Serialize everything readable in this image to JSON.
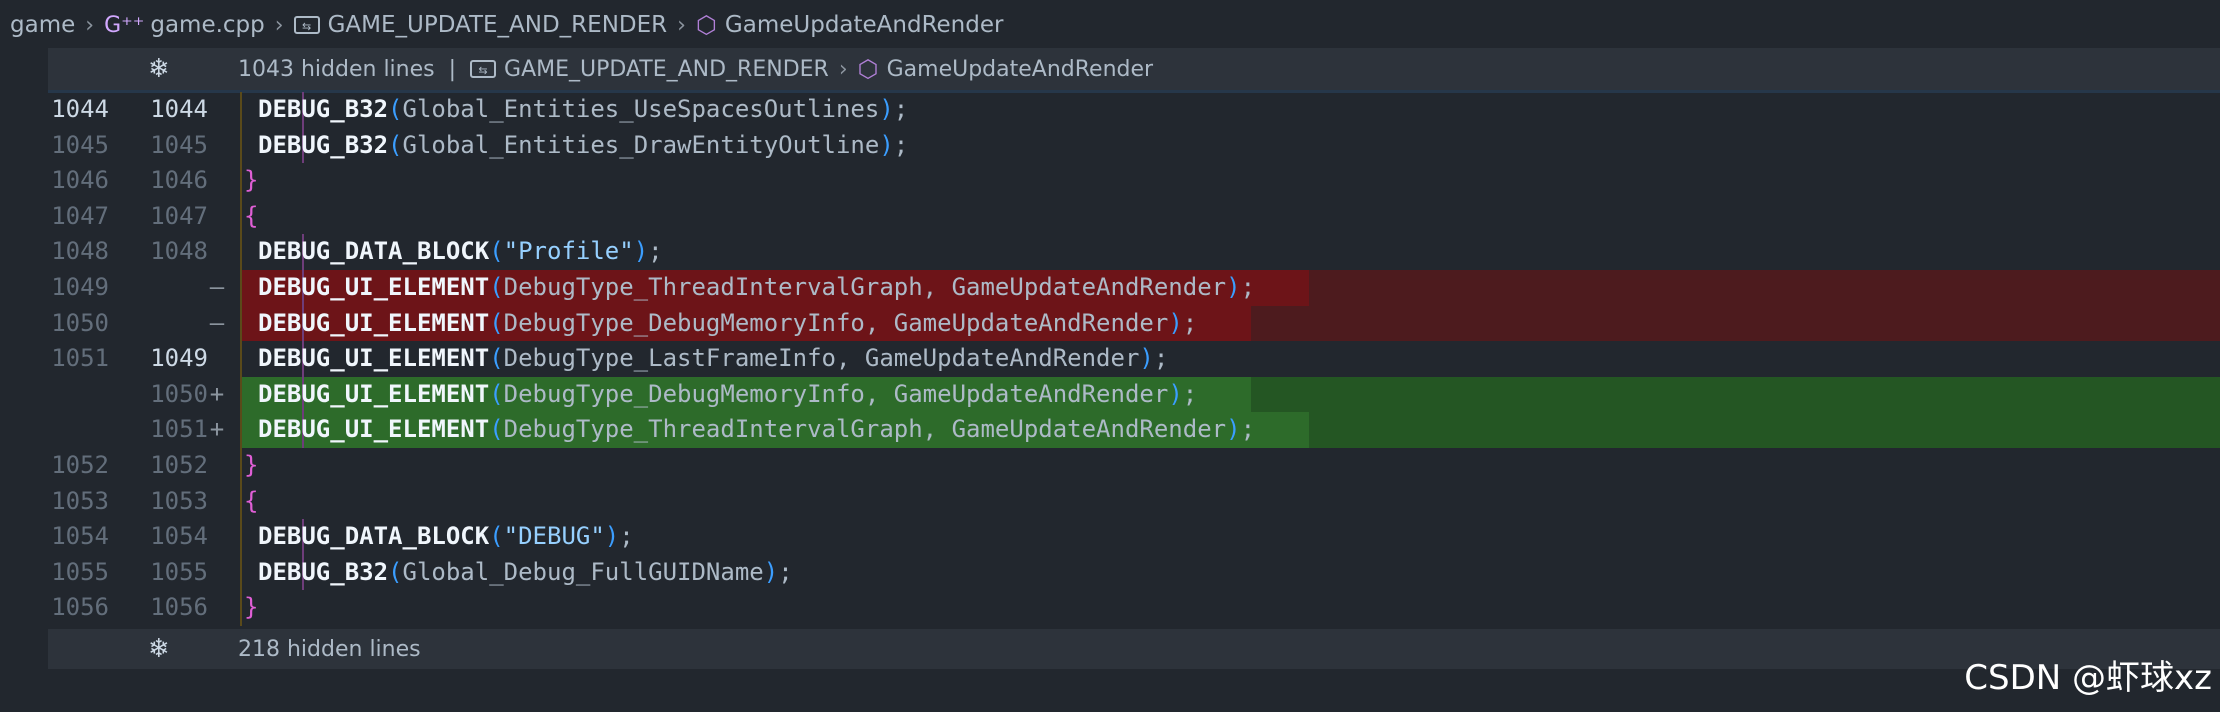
{
  "breadcrumb": {
    "folder": "game",
    "file": "game.cpp",
    "macro": "GAME_UPDATE_AND_RENDER",
    "function": "GameUpdateAndRender"
  },
  "hidden_top": {
    "count": "1043 hidden lines",
    "pipe": "|",
    "macro": "GAME_UPDATE_AND_RENDER",
    "function": "GameUpdateAndRender"
  },
  "hidden_bottom": {
    "count": "218 hidden lines"
  },
  "lines": [
    {
      "old": "1044",
      "new": "1044",
      "type": "ctx",
      "active": true,
      "indent": 1,
      "parts": [
        [
          "kw",
          "DEBUG_B32"
        ],
        [
          "pa",
          "("
        ],
        [
          "id",
          "Global_Entities_UseSpacesOutlines"
        ],
        [
          "pa",
          ")"
        ],
        [
          "id",
          ";"
        ]
      ]
    },
    {
      "old": "1045",
      "new": "1045",
      "type": "ctx",
      "indent": 1,
      "parts": [
        [
          "kw",
          "DEBUG_B32"
        ],
        [
          "pa",
          "("
        ],
        [
          "id",
          "Global_Entities_DrawEntityOutline"
        ],
        [
          "pa",
          ")"
        ],
        [
          "id",
          ";"
        ]
      ]
    },
    {
      "old": "1046",
      "new": "1046",
      "type": "ctx",
      "indent": 0,
      "parts": [
        [
          "br",
          "}"
        ]
      ]
    },
    {
      "old": "1047",
      "new": "1047",
      "type": "ctx",
      "indent": 0,
      "parts": [
        [
          "br",
          "{"
        ]
      ]
    },
    {
      "old": "1048",
      "new": "1048",
      "type": "ctx",
      "indent": 1,
      "parts": [
        [
          "kw",
          "DEBUG_DATA_BLOCK"
        ],
        [
          "pa",
          "("
        ],
        [
          "str",
          "\"Profile\""
        ],
        [
          "pa",
          ")"
        ],
        [
          "id",
          ";"
        ]
      ]
    },
    {
      "old": "1049",
      "new": "",
      "marker": "—",
      "type": "del",
      "indent": 1,
      "parts": [
        [
          "kw",
          "DEBUG_UI_ELEMENT"
        ],
        [
          "pa",
          "("
        ],
        [
          "id",
          "DebugType_ThreadIntervalGraph, GameUpdateAndRender"
        ],
        [
          "pa",
          ")"
        ],
        [
          "id",
          ";"
        ]
      ]
    },
    {
      "old": "1050",
      "new": "",
      "marker": "—",
      "type": "del",
      "indent": 1,
      "parts": [
        [
          "kw",
          "DEBUG_UI_ELEMENT"
        ],
        [
          "pa",
          "("
        ],
        [
          "id",
          "DebugType_DebugMemoryInfo, GameUpdateAndRender"
        ],
        [
          "pa",
          ")"
        ],
        [
          "id",
          ";"
        ]
      ]
    },
    {
      "old": "1051",
      "new": "1049",
      "type": "ctx",
      "newActive": true,
      "indent": 1,
      "parts": [
        [
          "kw",
          "DEBUG_UI_ELEMENT"
        ],
        [
          "pa",
          "("
        ],
        [
          "id",
          "DebugType_LastFrameInfo, GameUpdateAndRender"
        ],
        [
          "pa",
          ")"
        ],
        [
          "id",
          ";"
        ]
      ]
    },
    {
      "old": "",
      "new": "1050",
      "marker": "+",
      "type": "add",
      "indent": 1,
      "parts": [
        [
          "kw",
          "DEBUG_UI_ELEMENT"
        ],
        [
          "pa",
          "("
        ],
        [
          "id",
          "DebugType_DebugMemoryInfo, GameUpdateAndRender"
        ],
        [
          "pa",
          ")"
        ],
        [
          "id",
          ";"
        ]
      ]
    },
    {
      "old": "",
      "new": "1051",
      "marker": "+",
      "type": "add",
      "indent": 1,
      "parts": [
        [
          "kw",
          "DEBUG_UI_ELEMENT"
        ],
        [
          "pa",
          "("
        ],
        [
          "id",
          "DebugType_ThreadIntervalGraph, GameUpdateAndRender"
        ],
        [
          "pa",
          ")"
        ],
        [
          "id",
          ";"
        ]
      ]
    },
    {
      "old": "1052",
      "new": "1052",
      "type": "ctx",
      "indent": 0,
      "parts": [
        [
          "br",
          "}"
        ]
      ]
    },
    {
      "old": "1053",
      "new": "1053",
      "type": "ctx",
      "indent": 0,
      "parts": [
        [
          "br",
          "{"
        ]
      ]
    },
    {
      "old": "1054",
      "new": "1054",
      "type": "ctx",
      "indent": 1,
      "parts": [
        [
          "kw",
          "DEBUG_DATA_BLOCK"
        ],
        [
          "pa",
          "("
        ],
        [
          "str",
          "\"DEBUG\""
        ],
        [
          "pa",
          ")"
        ],
        [
          "id",
          ";"
        ]
      ]
    },
    {
      "old": "1055",
      "new": "1055",
      "type": "ctx",
      "indent": 1,
      "parts": [
        [
          "kw",
          "DEBUG_B32"
        ],
        [
          "pa",
          "("
        ],
        [
          "id",
          "Global_Debug_FullGUIDName"
        ],
        [
          "pa",
          ")"
        ],
        [
          "id",
          ";"
        ]
      ]
    },
    {
      "old": "1056",
      "new": "1056",
      "type": "ctx",
      "indent": 0,
      "parts": [
        [
          "br",
          "}"
        ]
      ]
    }
  ],
  "watermark": "CSDN @虾球xz",
  "icons": {
    "file": "cpp-file-icon",
    "macro": "symbol-macro-icon",
    "function": "symbol-method-icon",
    "expand": "unfold-icon"
  }
}
